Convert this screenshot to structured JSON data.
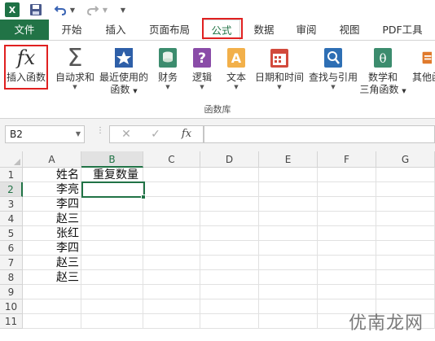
{
  "quick_access": {
    "app_icon": "excel-icon",
    "app_letter": "X",
    "buttons": [
      "save-icon",
      "undo-icon",
      "redo-icon",
      "customize-icon"
    ]
  },
  "tabs": [
    {
      "label": "文件"
    },
    {
      "label": "开始"
    },
    {
      "label": "插入"
    },
    {
      "label": "页面布局"
    },
    {
      "label": "公式",
      "active": true
    },
    {
      "label": "数据"
    },
    {
      "label": "审阅"
    },
    {
      "label": "视图"
    },
    {
      "label": "PDF工具"
    }
  ],
  "ribbon": {
    "insert_function": {
      "icon_text": "fx",
      "label": "插入函数"
    },
    "autosum": {
      "icon_text": "Σ",
      "label": "自动求和"
    },
    "recent": {
      "label_line1": "最近使用的",
      "label_line2": "函数"
    },
    "financial": {
      "label": "财务"
    },
    "logical": {
      "icon_text": "?",
      "label": "逻辑"
    },
    "text": {
      "icon_text": "A",
      "label": "文本"
    },
    "datetime": {
      "label": "日期和时间"
    },
    "lookup": {
      "label": "查找与引用"
    },
    "math": {
      "icon_text": "θ",
      "label_line1": "数学和",
      "label_line2": "三角函数"
    },
    "other": {
      "label": "其他函"
    },
    "group_label": "函数库"
  },
  "formula_bar": {
    "name_box": "B2",
    "cancel_symbol": "✕",
    "enter_symbol": "✓",
    "fx_symbol": "fx",
    "formula": ""
  },
  "grid": {
    "columns": [
      "A",
      "B",
      "C",
      "D",
      "E",
      "F",
      "G"
    ],
    "rows": [
      "1",
      "2",
      "3",
      "4",
      "5",
      "6",
      "7",
      "8",
      "9",
      "10",
      "11"
    ],
    "col_a": [
      "姓名",
      "李亮",
      "李四",
      "赵三",
      "张红",
      "李四",
      "赵三",
      "赵三",
      "",
      "",
      ""
    ],
    "col_b": [
      "重复数量",
      "",
      "",
      "",
      "",
      "",
      "",
      "",
      "",
      "",
      ""
    ],
    "active_cell": "B2"
  },
  "watermark": "优南龙网",
  "colors": {
    "accent": "#217346",
    "highlight": "#e02020"
  }
}
